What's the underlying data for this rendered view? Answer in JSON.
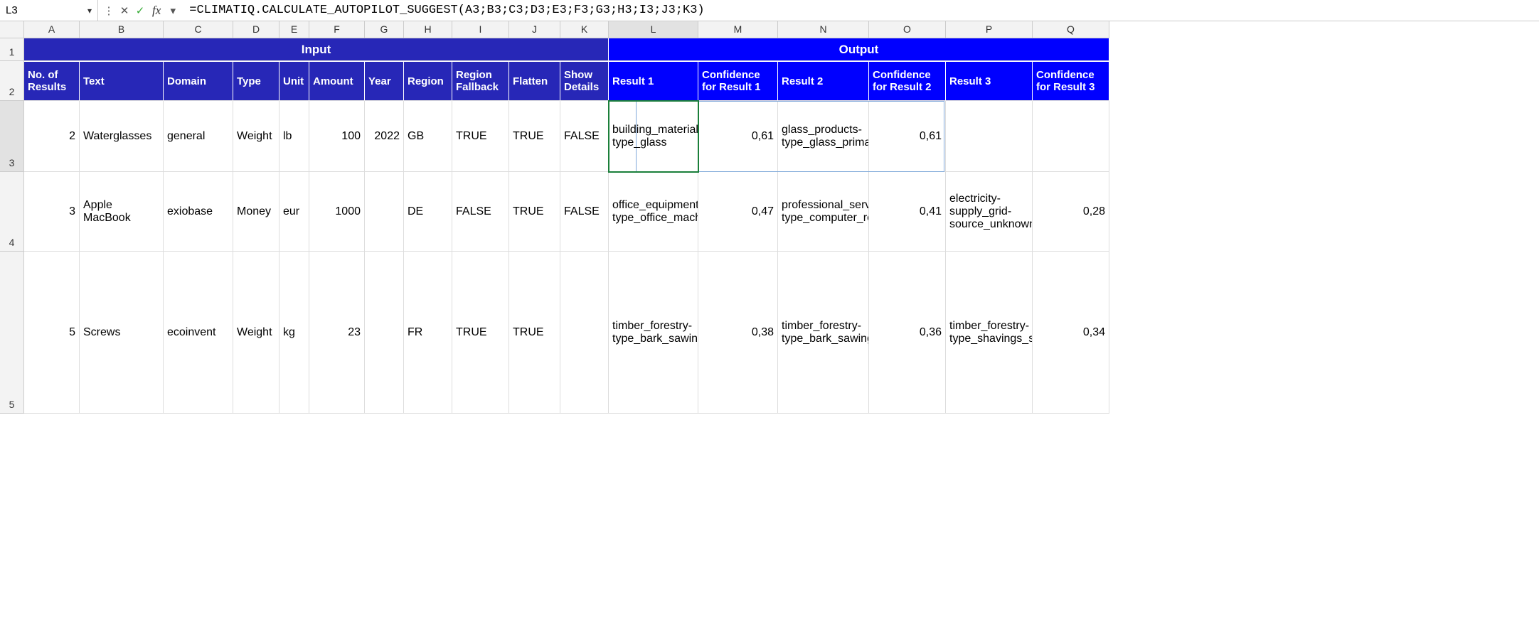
{
  "name_box": "L3",
  "formula": "=CLIMATIQ.CALCULATE_AUTOPILOT_SUGGEST(A3;B3;C3;D3;E3;F3;G3;H3;I3;J3;K3)",
  "columns": [
    "A",
    "B",
    "C",
    "D",
    "E",
    "F",
    "G",
    "H",
    "I",
    "J",
    "K",
    "L",
    "M",
    "N",
    "O",
    "P",
    "Q"
  ],
  "active_col": "L",
  "row_nums": [
    "1",
    "2",
    "3",
    "4",
    "5"
  ],
  "active_row": "3",
  "groups": {
    "input": "Input",
    "output": "Output"
  },
  "headers": {
    "A": "No. of Results",
    "B": "Text",
    "C": "Domain",
    "D": "Type",
    "E": "Unit",
    "F": "Amount",
    "G": "Year",
    "H": "Region",
    "I": "Region Fallback",
    "J": "Flatten",
    "K": "Show Details",
    "L": "Result 1",
    "M": "Confidence for Result 1",
    "N": "Result 2",
    "O": "Confidence for Result 2",
    "P": "Result 3",
    "Q": "Confidence for Result 3"
  },
  "rows": [
    {
      "A": "2",
      "B": "Waterglasses",
      "C": "general",
      "D": "Weight",
      "E": "lb",
      "F": "100",
      "G": "2022",
      "H": "GB",
      "I": "TRUE",
      "J": "TRUE",
      "K": "FALSE",
      "L": "building_materials-type_glass",
      "M": "0,61",
      "N": "glass_products-type_glass_primary_material_production",
      "O": "0,61",
      "P": "",
      "Q": ""
    },
    {
      "A": "3",
      "B": "Apple MacBook",
      "C": "exiobase",
      "D": "Money",
      "E": "eur",
      "F": "1000",
      "G": "",
      "H": "DE",
      "I": "FALSE",
      "J": "TRUE",
      "K": "FALSE",
      "L": "office_equipment-type_office_machinery_computers",
      "M": "0,47",
      "N": "professional_services-type_computer_related_services",
      "O": "0,41",
      "P": "electricity-supply_grid-source_unknown",
      "Q": "0,28"
    },
    {
      "A": "5",
      "B": "Screws",
      "C": "ecoinvent",
      "D": "Weight",
      "E": "kg",
      "F": "23",
      "G": "",
      "H": "FR",
      "I": "TRUE",
      "J": "TRUE",
      "K": "",
      "L": "timber_forestry-type_bark_sawing_hardwood",
      "M": "0,38",
      "N": "timber_forestry-type_bark_sawing_softwood",
      "O": "0,36",
      "P": "timber_forestry-type_shavings_softwood_loose_measured_as_dry_mass_glued_laminated_timber_production_muf_glue",
      "Q": "0,34"
    }
  ],
  "row_heights": [
    "32",
    "56",
    "100",
    "112",
    "228"
  ]
}
